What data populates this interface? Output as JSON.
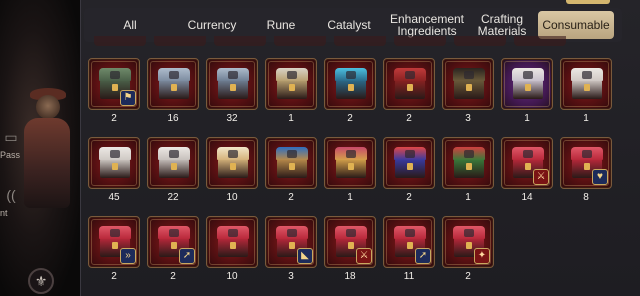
{
  "side": {
    "labels": [
      "Pass",
      "nt"
    ]
  },
  "tabs": [
    {
      "label": "All",
      "active": false
    },
    {
      "label": "Currency",
      "active": false
    },
    {
      "label": "Rune",
      "active": false
    },
    {
      "label": "Catalyst",
      "active": false
    },
    {
      "label": "Enhancement Ingredients",
      "active": false
    },
    {
      "label": "Crafting Materials",
      "active": false
    },
    {
      "label": "Consumable",
      "active": true
    }
  ],
  "items": [
    {
      "qty": "2",
      "lid": "#6f8a6a",
      "box": "#4a5f48",
      "badge": "flag"
    },
    {
      "qty": "16",
      "lid": "#aebccc",
      "box": "#7d8ca0",
      "badge": ""
    },
    {
      "qty": "32",
      "lid": "#aebccc",
      "box": "#6f7f94",
      "badge": ""
    },
    {
      "qty": "1",
      "lid": "#d9d4c8",
      "box": "#b8a070",
      "badge": ""
    },
    {
      "qty": "2",
      "lid": "#4cc0e0",
      "box": "#2a6a8a",
      "badge": ""
    },
    {
      "qty": "2",
      "lid": "#c03a3a",
      "box": "#8a2222",
      "badge": ""
    },
    {
      "qty": "3",
      "lid": "#2a2420",
      "box": "#6a5a3a",
      "badge": ""
    },
    {
      "qty": "1",
      "lid": "#ece8e4",
      "box": "#c8c0cc",
      "badge": "",
      "purple": true
    },
    {
      "qty": "1",
      "lid": "#ece8e4",
      "box": "#d0c8c4",
      "badge": ""
    },
    {
      "qty": "45",
      "lid": "#ece8e4",
      "box": "#cfc9c4",
      "badge": ""
    },
    {
      "qty": "22",
      "lid": "#ece8e4",
      "box": "#c7c0bc",
      "badge": ""
    },
    {
      "qty": "10",
      "lid": "#f2e6c8",
      "box": "#d4b27a",
      "badge": ""
    },
    {
      "qty": "2",
      "lid": "#2f6ec0",
      "box": "#b88a4a",
      "badge": ""
    },
    {
      "qty": "1",
      "lid": "#c84a6a",
      "box": "#d4a04a",
      "badge": ""
    },
    {
      "qty": "2",
      "lid": "#e04848",
      "box": "#3a3aa0",
      "badge": ""
    },
    {
      "qty": "1",
      "lid": "#d04040",
      "box": "#3a7a3a",
      "badge": ""
    },
    {
      "qty": "14",
      "lid": "#e05868",
      "box": "#b8283a",
      "badge": "sword",
      "red": true
    },
    {
      "qty": "8",
      "lid": "#e05868",
      "box": "#b8283a",
      "badge": "shield"
    },
    {
      "qty": "2",
      "lid": "#e05868",
      "box": "#b8283a",
      "badge": "wing"
    },
    {
      "qty": "2",
      "lid": "#e05868",
      "box": "#b8283a",
      "badge": "arrow"
    },
    {
      "qty": "10",
      "lid": "#e05868",
      "box": "#b8283a",
      "badge": ""
    },
    {
      "qty": "3",
      "lid": "#e05868",
      "box": "#b8283a",
      "badge": "boot"
    },
    {
      "qty": "18",
      "lid": "#e05868",
      "box": "#b8283a",
      "badge": "sword",
      "red": true
    },
    {
      "qty": "11",
      "lid": "#e05868",
      "box": "#b8283a",
      "badge": "arrow"
    },
    {
      "qty": "2",
      "lid": "#e05868",
      "box": "#b8283a",
      "badge": "flame",
      "red": true
    }
  ],
  "badge_glyphs": {
    "flag": "⚑",
    "sword": "⚔",
    "shield": "♥",
    "wing": "»",
    "arrow": "➚",
    "boot": "◣",
    "flame": "✦"
  }
}
